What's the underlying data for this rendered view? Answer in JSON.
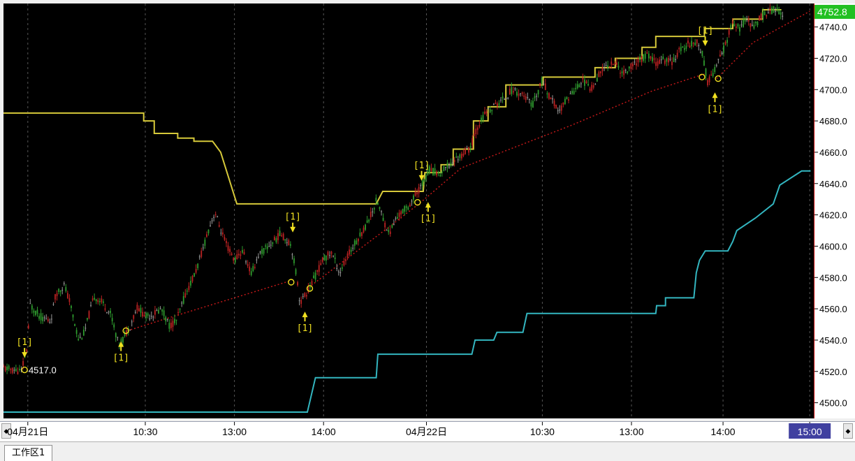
{
  "colors": {
    "plot_bg": "#000000",
    "upper_line": "#d6c93a",
    "lower_line": "#33b6c0",
    "trend_line": "#c01818",
    "candle_up": "#bb2222",
    "candle_down": "#2e9a2e",
    "candle_flat": "#9a9a9a",
    "marker": "#f0e020",
    "last_price_bg": "#22c022",
    "grid": "#555555",
    "axis_border": "#c00000"
  },
  "chart_data": {
    "type": "line",
    "ylim": [
      4490,
      4755
    ],
    "yticks": [
      4500,
      4520,
      4540,
      4560,
      4580,
      4600,
      4620,
      4640,
      4660,
      4680,
      4700,
      4720,
      4740
    ],
    "ytick_labels": [
      "4500.0",
      "4520.0",
      "4540.0",
      "4560.0",
      "4580.0",
      "4600.0",
      "4620.0",
      "4640.0",
      "4660.0",
      "4680.0",
      "4700.0",
      "4720.0",
      "4740.0"
    ],
    "xlim": [
      0,
      100
    ],
    "xticks": [
      {
        "x": 3,
        "label": "04月21日"
      },
      {
        "x": 17.5,
        "label": "10:30"
      },
      {
        "x": 28.5,
        "label": "13:00"
      },
      {
        "x": 39.5,
        "label": "14:00"
      },
      {
        "x": 52.2,
        "label": "04月22日"
      },
      {
        "x": 66.5,
        "label": "10:30"
      },
      {
        "x": 77.5,
        "label": "13:00"
      },
      {
        "x": 88.8,
        "label": "14:00"
      },
      {
        "x": 99.5,
        "label": "15:00",
        "highlight": true
      }
    ],
    "last_price": "4752.8",
    "series": [
      {
        "type": "step",
        "role": "upper",
        "points": [
          [
            0,
            4685
          ],
          [
            17.3,
            4685
          ],
          [
            17.3,
            4680
          ],
          [
            18.6,
            4680
          ],
          [
            18.6,
            4672
          ],
          [
            21.5,
            4672
          ],
          [
            21.5,
            4669
          ],
          [
            23.5,
            4669
          ],
          [
            23.5,
            4667
          ],
          [
            25.8,
            4667
          ],
          [
            26.8,
            4660
          ],
          [
            28.8,
            4627
          ],
          [
            46,
            4627
          ],
          [
            46.8,
            4635
          ],
          [
            51.8,
            4635
          ],
          [
            52,
            4647
          ],
          [
            54,
            4647
          ],
          [
            54,
            4652
          ],
          [
            55.5,
            4652
          ],
          [
            55.5,
            4662
          ],
          [
            58,
            4662
          ],
          [
            58,
            4680
          ],
          [
            59.8,
            4680
          ],
          [
            59.8,
            4689
          ],
          [
            62,
            4689
          ],
          [
            62,
            4703
          ],
          [
            66.6,
            4703
          ],
          [
            66.6,
            4708
          ],
          [
            73,
            4708
          ],
          [
            73,
            4714
          ],
          [
            75.5,
            4714
          ],
          [
            75.5,
            4720
          ],
          [
            78.8,
            4720
          ],
          [
            78.8,
            4727
          ],
          [
            80.5,
            4727
          ],
          [
            80.5,
            4734
          ],
          [
            86.5,
            4734
          ],
          [
            86.5,
            4739
          ],
          [
            90,
            4739
          ],
          [
            90,
            4745
          ],
          [
            93.7,
            4745
          ],
          [
            93.7,
            4751
          ],
          [
            96,
            4751
          ]
        ]
      },
      {
        "type": "step",
        "role": "lower",
        "points": [
          [
            0,
            4494
          ],
          [
            37.5,
            4494
          ],
          [
            38.5,
            4516
          ],
          [
            46,
            4516
          ],
          [
            46.2,
            4531
          ],
          [
            57.8,
            4531
          ],
          [
            58.2,
            4540
          ],
          [
            60.5,
            4540
          ],
          [
            60.9,
            4545
          ],
          [
            64.1,
            4545
          ],
          [
            64.6,
            4557
          ],
          [
            80.5,
            4557
          ],
          [
            80.6,
            4562
          ],
          [
            81.7,
            4562
          ],
          [
            81.7,
            4567
          ],
          [
            85.2,
            4567
          ],
          [
            85.5,
            4583
          ],
          [
            85.9,
            4591
          ],
          [
            86.6,
            4597
          ],
          [
            89.4,
            4597
          ],
          [
            90,
            4603
          ],
          [
            90.5,
            4610
          ],
          [
            92.8,
            4618
          ],
          [
            95,
            4627
          ],
          [
            95.8,
            4639
          ],
          [
            98.5,
            4648
          ],
          [
            99.6,
            4648
          ]
        ]
      },
      {
        "type": "dotted",
        "role": "trend",
        "segments": [
          [
            [
              15.3,
              4546
            ],
            [
              19,
              4552
            ],
            [
              21.5,
              4556
            ],
            [
              35.5,
              4578
            ]
          ],
          [
            [
              38,
              4575
            ],
            [
              47,
              4610
            ],
            [
              51.5,
              4628
            ],
            [
              56.5,
              4650
            ],
            [
              70,
              4677
            ],
            [
              80,
              4699
            ],
            [
              86.5,
              4710
            ]
          ],
          [
            [
              88,
              4707
            ],
            [
              92.5,
              4730
            ],
            [
              99.5,
              4750
            ]
          ]
        ]
      },
      {
        "type": "price",
        "role": "candles",
        "points": [
          [
            0,
            4522
          ],
          [
            2.2,
            4520
          ],
          [
            3,
            4537
          ],
          [
            3.2,
            4563
          ],
          [
            4.5,
            4555
          ],
          [
            5.8,
            4552
          ],
          [
            6.5,
            4570
          ],
          [
            7.5,
            4575
          ],
          [
            8.2,
            4564
          ],
          [
            8.9,
            4548
          ],
          [
            9.3,
            4540
          ],
          [
            10,
            4545
          ],
          [
            10.6,
            4557
          ],
          [
            11.2,
            4568
          ],
          [
            12.2,
            4564
          ],
          [
            13.3,
            4556
          ],
          [
            14.2,
            4537
          ],
          [
            14.9,
            4542
          ],
          [
            15.6,
            4549
          ],
          [
            16.5,
            4561
          ],
          [
            17.6,
            4555
          ],
          [
            18.6,
            4557
          ],
          [
            19.5,
            4560
          ],
          [
            20.5,
            4549
          ],
          [
            21.4,
            4553
          ],
          [
            22.5,
            4570
          ],
          [
            23.6,
            4582
          ],
          [
            24.5,
            4596
          ],
          [
            25.2,
            4609
          ],
          [
            26.1,
            4622
          ],
          [
            26.7,
            4612
          ],
          [
            27.5,
            4601
          ],
          [
            28.5,
            4591
          ],
          [
            29.5,
            4597
          ],
          [
            30.6,
            4582
          ],
          [
            31.4,
            4594
          ],
          [
            32.5,
            4599
          ],
          [
            33.5,
            4604
          ],
          [
            34.2,
            4608
          ],
          [
            35.5,
            4601
          ],
          [
            36.2,
            4580
          ],
          [
            36.6,
            4564
          ],
          [
            37.3,
            4569
          ],
          [
            38.4,
            4580
          ],
          [
            39.5,
            4592
          ],
          [
            40.5,
            4596
          ],
          [
            41.5,
            4583
          ],
          [
            42.5,
            4594
          ],
          [
            43.5,
            4603
          ],
          [
            44.5,
            4611
          ],
          [
            45.5,
            4622
          ],
          [
            46.1,
            4630
          ],
          [
            46.8,
            4618
          ],
          [
            47.6,
            4608
          ],
          [
            48.5,
            4618
          ],
          [
            49.2,
            4622
          ],
          [
            50,
            4626
          ],
          [
            50.8,
            4632
          ],
          [
            51.5,
            4638
          ],
          [
            52.5,
            4649
          ],
          [
            53.8,
            4646
          ],
          [
            55,
            4652
          ],
          [
            56.2,
            4657
          ],
          [
            57.5,
            4662
          ],
          [
            58.5,
            4676
          ],
          [
            59.5,
            4685
          ],
          [
            60.5,
            4689
          ],
          [
            61.5,
            4693
          ],
          [
            62.8,
            4700
          ],
          [
            64,
            4697
          ],
          [
            65.3,
            4690
          ],
          [
            66.5,
            4706
          ],
          [
            67.5,
            4694
          ],
          [
            68.6,
            4686
          ],
          [
            69.5,
            4694
          ],
          [
            70.5,
            4700
          ],
          [
            71.5,
            4706
          ],
          [
            72.5,
            4700
          ],
          [
            73.5,
            4710
          ],
          [
            74.5,
            4716
          ],
          [
            75.5,
            4717
          ],
          [
            76.5,
            4710
          ],
          [
            77.5,
            4715
          ],
          [
            78.5,
            4719
          ],
          [
            79.5,
            4722
          ],
          [
            80.5,
            4717
          ],
          [
            81.5,
            4719
          ],
          [
            82.5,
            4718
          ],
          [
            83.5,
            4725
          ],
          [
            84.5,
            4729
          ],
          [
            85.5,
            4731
          ],
          [
            86.2,
            4724
          ],
          [
            86.9,
            4705
          ],
          [
            87.5,
            4710
          ],
          [
            88.3,
            4718
          ],
          [
            89.2,
            4730
          ],
          [
            89.9,
            4742
          ],
          [
            90.8,
            4739
          ],
          [
            91.8,
            4745
          ],
          [
            92.6,
            4739
          ],
          [
            93.4,
            4747
          ],
          [
            94.3,
            4749
          ],
          [
            95.3,
            4752
          ],
          [
            96.2,
            4745
          ]
        ]
      }
    ],
    "annotations": [
      {
        "label": "[1]",
        "x": 2.6,
        "y": 4527,
        "dir": "down"
      },
      {
        "label": "[1]",
        "x": 14.5,
        "y": 4541,
        "dir": "up"
      },
      {
        "label": "[1]",
        "x": 35.7,
        "y": 4607,
        "dir": "down"
      },
      {
        "label": "[1]",
        "x": 37.2,
        "y": 4560,
        "dir": "up"
      },
      {
        "label": "[1]",
        "x": 51.6,
        "y": 4640,
        "dir": "down"
      },
      {
        "label": "[1]",
        "x": 52.4,
        "y": 4630,
        "dir": "up"
      },
      {
        "label": "[1]",
        "x": 86.6,
        "y": 4726,
        "dir": "down"
      },
      {
        "label": "[1]",
        "x": 87.8,
        "y": 4700,
        "dir": "up"
      }
    ],
    "circles": [
      {
        "x": 2.6,
        "y": 4521
      },
      {
        "x": 15.1,
        "y": 4546
      },
      {
        "x": 35.5,
        "y": 4577
      },
      {
        "x": 37.8,
        "y": 4573
      },
      {
        "x": 51.1,
        "y": 4628
      },
      {
        "x": 86.2,
        "y": 4708
      },
      {
        "x": 88.2,
        "y": 4707
      }
    ],
    "text_labels": [
      {
        "text": "4517.0",
        "x": 3.1,
        "y": 4521
      }
    ]
  },
  "tabs": [
    {
      "label": "工作区1"
    }
  ]
}
